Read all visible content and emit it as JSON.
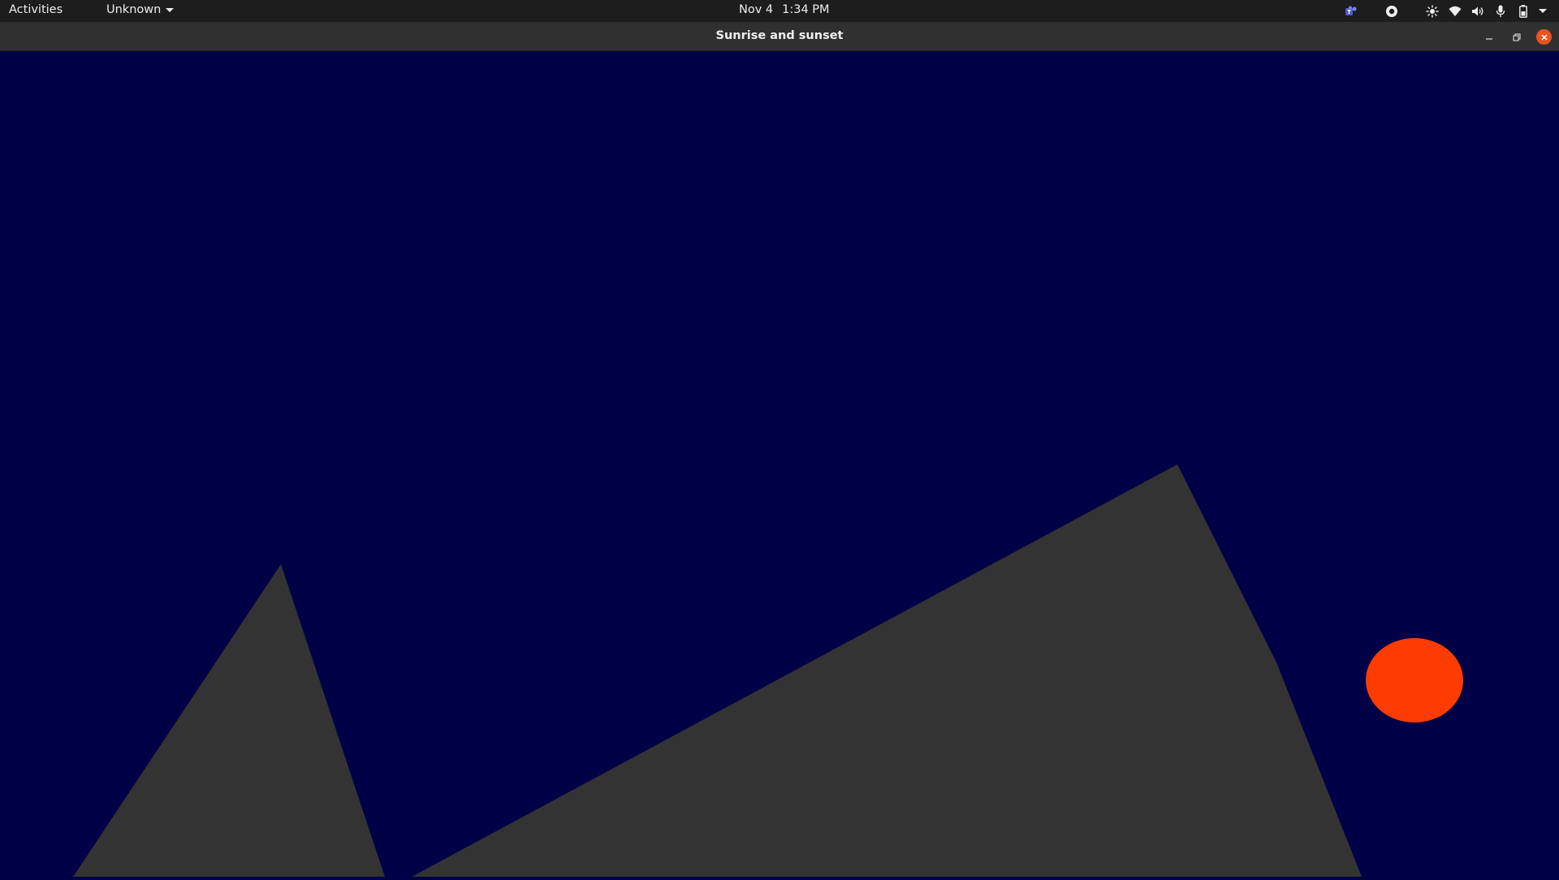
{
  "topbar": {
    "activities_label": "Activities",
    "app_menu_label": "Unknown",
    "date": "Nov 4",
    "time": "1:34 PM",
    "tray_icons": [
      "teams-icon",
      "record-icon",
      "brightness-icon",
      "wifi-icon",
      "volume-icon",
      "microphone-icon",
      "battery-icon",
      "system-menu-chevron-icon"
    ]
  },
  "window": {
    "title": "Sunrise and sunset",
    "controls": [
      "minimize",
      "maximize",
      "close"
    ],
    "accent_close_color": "#e95420"
  },
  "scene": {
    "sky_color": "#000046",
    "mountain_color": "#333333",
    "sun_color": "#ff3c00",
    "shapes": [
      "left-mountain",
      "right-mountain",
      "sun"
    ]
  }
}
